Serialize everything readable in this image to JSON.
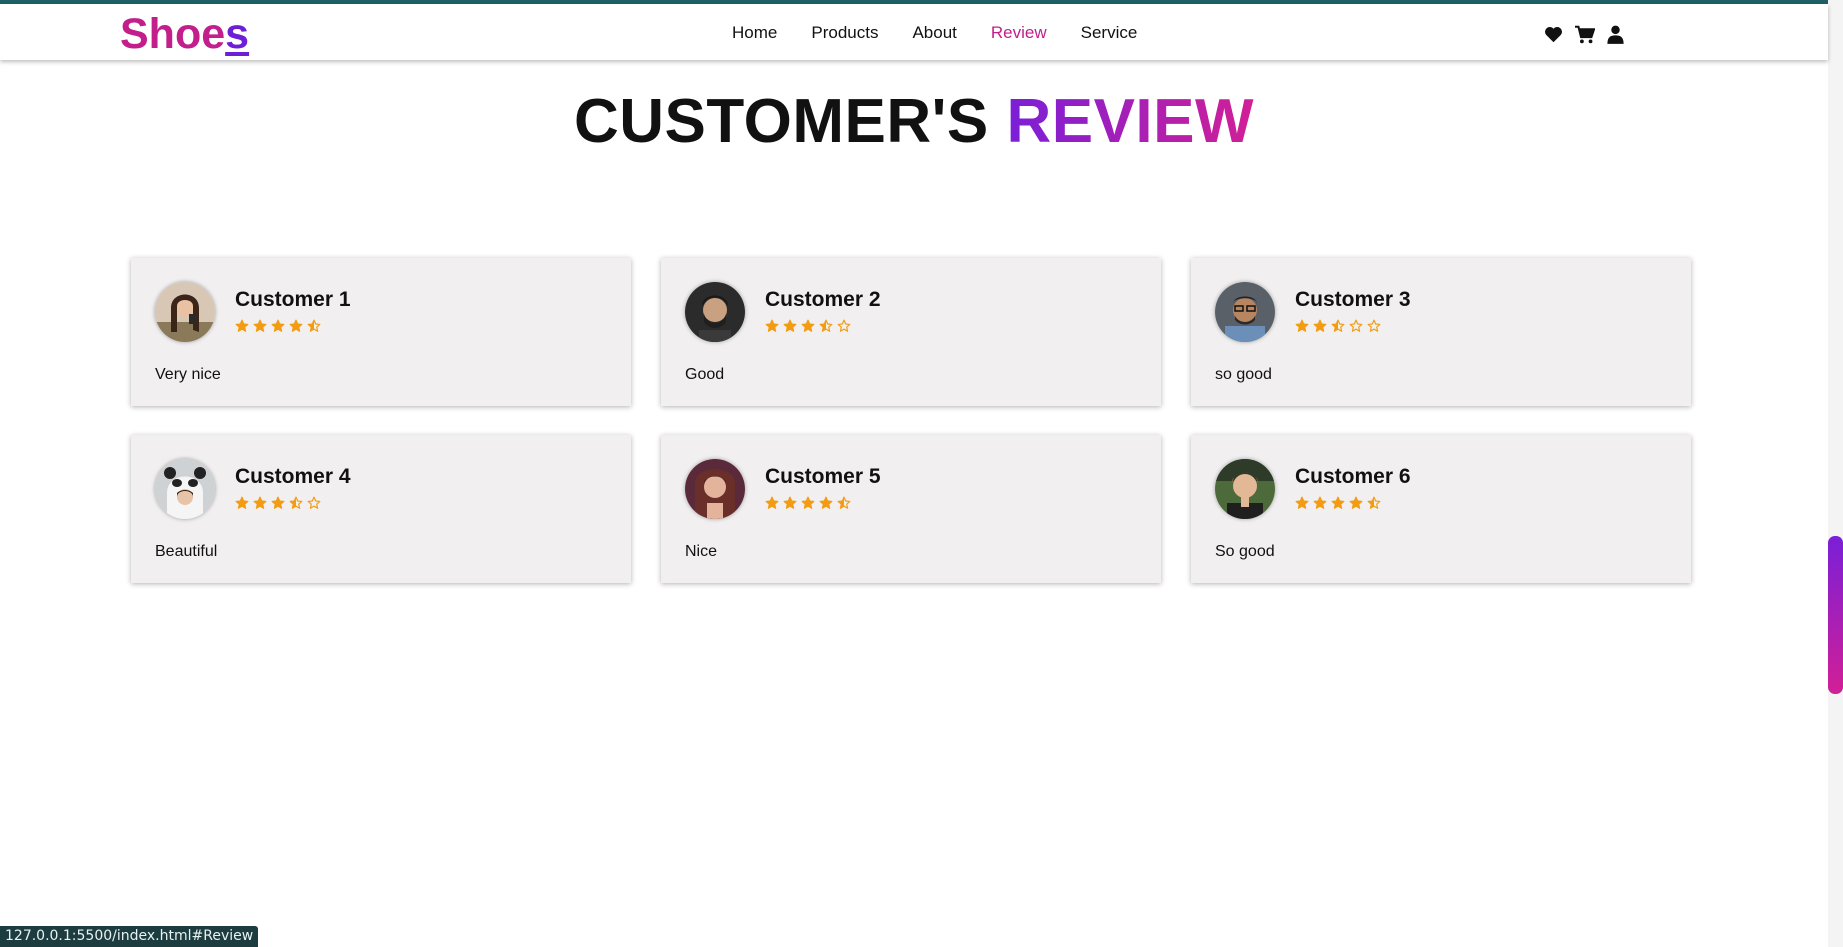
{
  "brand": {
    "logo_main": "Shoe",
    "logo_last": "s",
    "colors": {
      "accent_pink": "#c21e8c",
      "accent_purple": "#7a1fd8",
      "star": "#f39c12"
    }
  },
  "nav": {
    "links": [
      {
        "label": "Home"
      },
      {
        "label": "Products"
      },
      {
        "label": "About"
      },
      {
        "label": "Review",
        "active": true
      },
      {
        "label": "Service"
      }
    ],
    "icons": [
      "heart-icon",
      "cart-icon",
      "user-icon"
    ]
  },
  "section": {
    "title_plain": "CUSTOMER'S",
    "title_accent": "REVIEW"
  },
  "reviews": [
    {
      "name": "Customer 1",
      "rating": 4.5,
      "text": "Very nice",
      "avatar": "customer-1-avatar"
    },
    {
      "name": "Customer 2",
      "rating": 3.5,
      "text": "Good",
      "avatar": "customer-2-avatar"
    },
    {
      "name": "Customer 3",
      "rating": 2.5,
      "text": "so good",
      "avatar": "customer-3-avatar"
    },
    {
      "name": "Customer 4",
      "rating": 3.5,
      "text": "Beautiful",
      "avatar": "customer-4-avatar"
    },
    {
      "name": "Customer 5",
      "rating": 4.5,
      "text": "Nice",
      "avatar": "customer-5-avatar"
    },
    {
      "name": "Customer 6",
      "rating": 4.5,
      "text": "So good",
      "avatar": "customer-6-avatar"
    }
  ],
  "status_bar": {
    "url": "127.0.0.1:5500/index.html#Review"
  }
}
